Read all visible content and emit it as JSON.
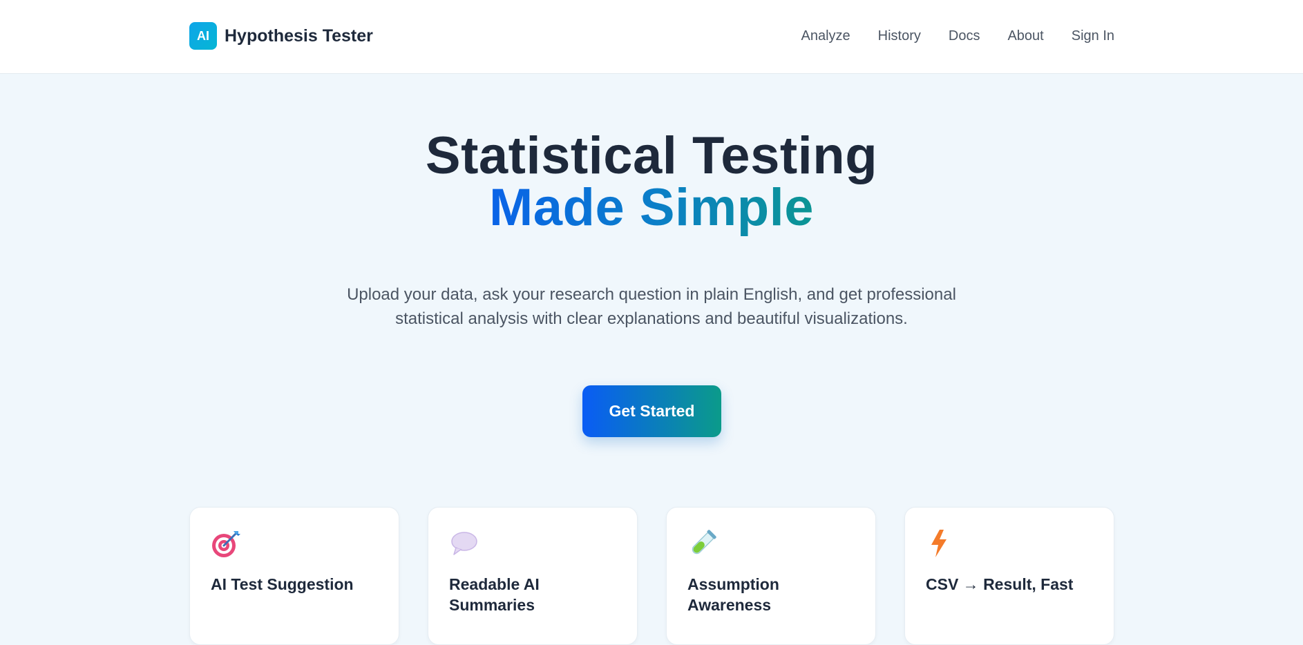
{
  "brand": {
    "logo_text": "AI",
    "name": "Hypothesis Tester"
  },
  "nav": {
    "items": [
      "Analyze",
      "History",
      "Docs",
      "About",
      "Sign In"
    ]
  },
  "hero": {
    "title_line1": "Statistical Testing",
    "title_line2": "Made Simple",
    "subtitle_line1": "Upload your data, ask your research question in plain English, and get professional",
    "subtitle_line2": "statistical analysis with clear explanations and beautiful visualizations.",
    "cta_label": "Get Started"
  },
  "features": [
    {
      "icon": "target-icon",
      "title": "AI Test Suggestion"
    },
    {
      "icon": "speech-bubble-icon",
      "title": "Readable AI Summaries"
    },
    {
      "icon": "test-tube-icon",
      "title": "Assumption Awareness"
    },
    {
      "icon": "lightning-icon",
      "title": "CSV → Result, Fast"
    }
  ],
  "colors": {
    "brand_gradient_start": "#0ea5e9",
    "accent_blue": "#0a5cf5",
    "accent_teal": "#0b9b8a",
    "heading": "#1e293b",
    "page_bg": "#f0f7fc"
  }
}
